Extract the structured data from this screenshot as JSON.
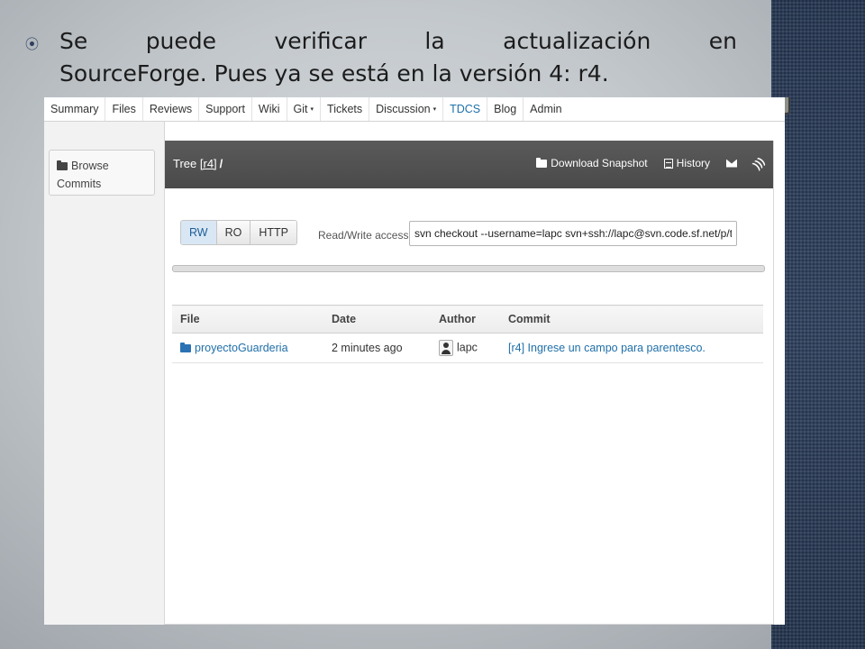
{
  "slide": {
    "bullet_icon": "circle-bullet",
    "line1_words": [
      "Se",
      "puede",
      "verificar",
      "la",
      "actualización",
      "en"
    ],
    "line2": "SourceForge. Pues ya se está en la versión 4: r4."
  },
  "nav": {
    "items": [
      {
        "label": "Summary"
      },
      {
        "label": "Files"
      },
      {
        "label": "Reviews"
      },
      {
        "label": "Support"
      },
      {
        "label": "Wiki"
      },
      {
        "label": "Git",
        "caret": "▾"
      },
      {
        "label": "Tickets"
      },
      {
        "label": "Discussion",
        "caret": "▾"
      },
      {
        "label": "TDCS"
      },
      {
        "label": "Blog"
      },
      {
        "label": "Admin"
      }
    ]
  },
  "sidebar": {
    "browse_commits": {
      "line1": "Browse",
      "line2": "Commits"
    }
  },
  "panel": {
    "title_prefix": "Tree",
    "title_ref": "[r4]",
    "title_sep": "/",
    "download_snapshot": "Download Snapshot",
    "history": "History"
  },
  "checkout": {
    "protocols": [
      "RW",
      "RO",
      "HTTP"
    ],
    "active_protocol": "RW",
    "label": "Read/Write access",
    "command": "svn checkout --username=lapc svn+ssh://lapc@svn.code.sf.net/p/teddy"
  },
  "table": {
    "headers": [
      "File",
      "Date",
      "Author",
      "Commit"
    ],
    "rows": [
      {
        "file": "proyectoGuarderia",
        "date": "2 minutes ago",
        "author": "lapc",
        "commit": "[r4] Ingrese un campo para parentesco."
      }
    ]
  },
  "colors": {
    "accent_link": "#1f6fa8",
    "header_bg": "#4f4f4f",
    "right_bar": "#2a3b57"
  }
}
